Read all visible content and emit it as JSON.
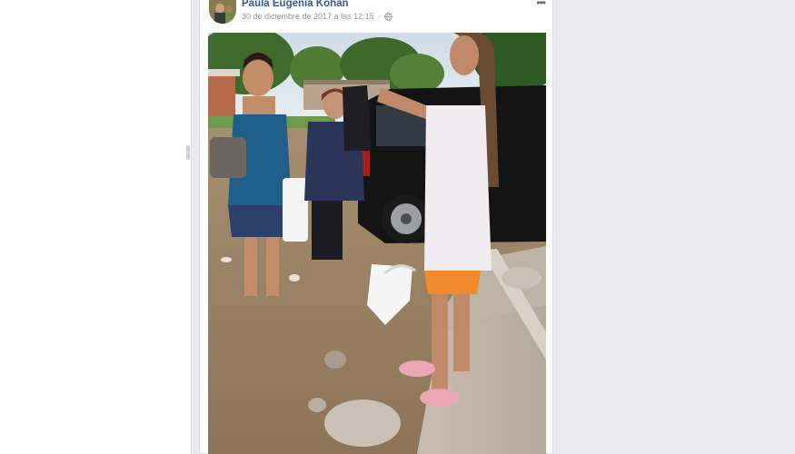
{
  "post": {
    "author": "Paula Eugenia Kohan",
    "timestamp": "30 de diciembre de 2017 a las 12:15",
    "more_icon": "ellipsis-icon",
    "privacy_icon": "globe-icon"
  },
  "colors": {
    "link_blue": "#365899",
    "meta_gray": "#90949c",
    "page_bg": "#e9ebee"
  }
}
